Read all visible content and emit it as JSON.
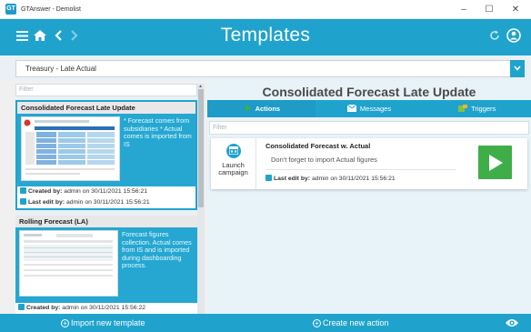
{
  "window": {
    "title": "GTAnswer - Demolist",
    "minimize": "–",
    "maximize": "☐",
    "close": "✕"
  },
  "header": {
    "title": "Templates"
  },
  "selector": {
    "value": "Treasury - Late Actual"
  },
  "left_panel": {
    "filter_placeholder": "Filter",
    "templates": [
      {
        "title": "Consolidated Forecast Late Update",
        "description": "* Forecast comes from subsidiaries * Actual comes is imported from IS",
        "created_label": "Created by:",
        "created_value": "admin on 30/11/2021 15:56:21",
        "edit_label": "Last edit by:",
        "edit_value": "admin on 30/11/2021 15:56:21"
      },
      {
        "title": "Rolling Forecast (LA)",
        "description": "Forecast figures collection. Actual comes from IS and is imported during dashboarding process.",
        "created_label": "Created by:",
        "created_value": "admin on 30/11/2021 15:56:22"
      }
    ]
  },
  "right_panel": {
    "title": "Consolidated Forecast Late Update",
    "tabs": [
      {
        "label": "Actions",
        "icon": "play-icon",
        "active": true
      },
      {
        "label": "Messages",
        "icon": "message-icon",
        "active": false
      },
      {
        "label": "Triggers",
        "icon": "puzzle-icon",
        "active": false
      }
    ],
    "filter_placeholder": "Filter",
    "actions": [
      {
        "launch_label": "Launch campaign",
        "name": "Consolidated Forecast w. Actual",
        "description": "Don't forget to import Actual figures",
        "edit_label": "Last edit by:",
        "edit_value": "admin on 30/11/2021 15:56:21"
      }
    ]
  },
  "footer": {
    "import_label": "Import new template",
    "create_label": "Create new action"
  },
  "colors": {
    "accent": "#1fa3cd",
    "play": "#3fae49",
    "panel": "#e7f3f8"
  }
}
